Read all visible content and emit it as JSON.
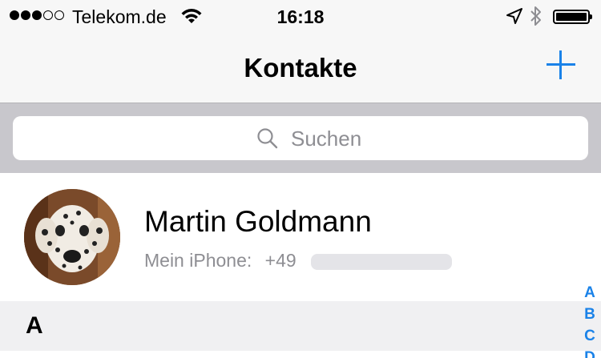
{
  "status_bar": {
    "signal_dots": [
      "filled",
      "filled",
      "filled",
      "empty",
      "empty"
    ],
    "carrier": "Telekom.de",
    "time": "16:18",
    "icons": [
      "wifi-icon",
      "location-arrow-icon",
      "bluetooth-icon",
      "battery-icon"
    ],
    "battery_level": 1.0
  },
  "nav": {
    "title": "Kontakte",
    "add_icon": "plus-icon"
  },
  "search": {
    "placeholder": "Suchen",
    "icon": "search-icon"
  },
  "my_card": {
    "name": "Martin Goldmann",
    "phone_label": "Mein iPhone:",
    "phone_prefix": "+49"
  },
  "section": {
    "letter": "A"
  },
  "index": [
    "A",
    "B",
    "C",
    "D"
  ],
  "colors": {
    "accent": "#1a82e8",
    "bar_background": "#f7f7f7",
    "search_area": "#c8c7cc",
    "secondary_text": "#8e8e93"
  }
}
